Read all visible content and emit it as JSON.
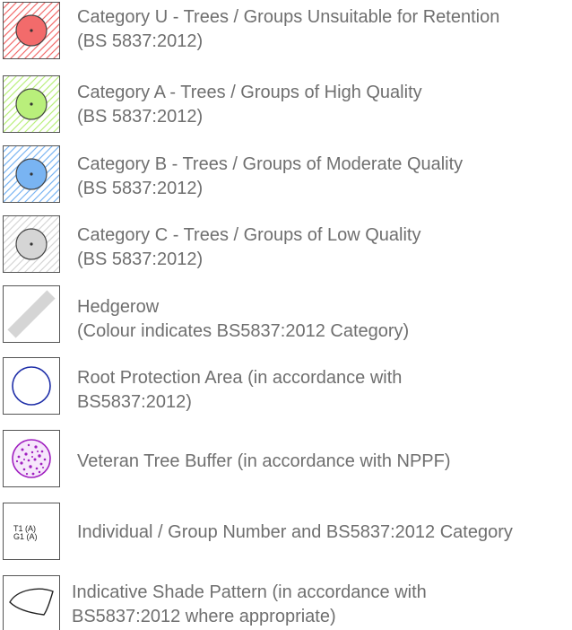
{
  "legend": {
    "items": [
      {
        "line1": "Category U - Trees / Groups Unsuitable for Retention",
        "line2": "(BS 5837:2012)",
        "symbol": "category-u",
        "fill": "#f26b6b",
        "hatch": "#f26b6b"
      },
      {
        "line1": "Category A - Trees / Groups of High Quality",
        "line2": "(BS 5837:2012)",
        "symbol": "category-a",
        "fill": "#b9ef7b",
        "hatch": "#b9ef7b"
      },
      {
        "line1": "Category B - Trees / Groups of Moderate Quality",
        "line2": "(BS 5837:2012)",
        "symbol": "category-b",
        "fill": "#79b4f2",
        "hatch": "#79b4f2"
      },
      {
        "line1": "Category C - Trees / Groups of Low Quality",
        "line2": "(BS 5837:2012)",
        "symbol": "category-c",
        "fill": "#d5d5d5",
        "hatch": "#d5d5d5"
      },
      {
        "line1": "Hedgerow",
        "line2": "(Colour indicates BS5837:2012 Category)",
        "symbol": "hedgerow",
        "fill": "#d5d5d5"
      },
      {
        "line1": "Root Protection Area (in accordance with",
        "line2": "BS5837:2012)",
        "symbol": "root-protection-area",
        "stroke": "#1f2fa8"
      },
      {
        "line1": "Veteran Tree Buffer (in accordance with NPPF)",
        "line2": "",
        "symbol": "veteran-tree-buffer",
        "stroke": "#a020c0"
      },
      {
        "line1": "Individual / Group Number and BS5837:2012 Category",
        "line2": "",
        "symbol": "tree-number",
        "tag1": "T1 (A)",
        "tag2": "G1 (A)"
      },
      {
        "line1": "Indicative Shade Pattern (in accordance with",
        "line2": "BS5837:2012 where appropriate)",
        "symbol": "shade-pattern"
      }
    ]
  }
}
